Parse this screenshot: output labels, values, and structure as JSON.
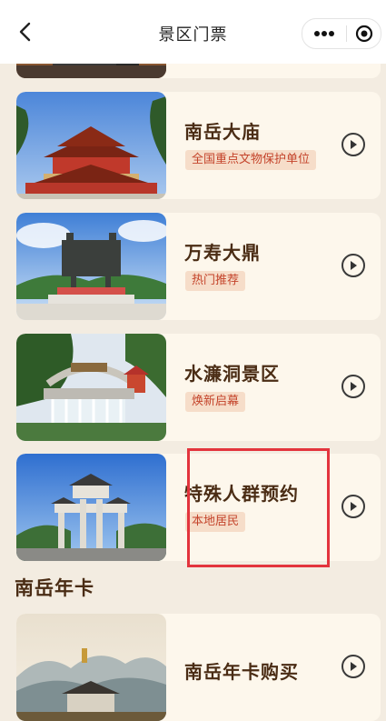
{
  "nav": {
    "title": "景区门票",
    "back_icon": "chevron-left-icon",
    "more_icon": "more-dots-icon",
    "close_icon": "target-circle-icon"
  },
  "cards": [
    {
      "name": "",
      "tag": ""
    },
    {
      "name": "南岳大庙",
      "tag": "全国重点文物保护单位"
    },
    {
      "name": "万寿大鼎",
      "tag": "热门推荐"
    },
    {
      "name": "水濂洞景区",
      "tag": "焕新启幕"
    },
    {
      "name": "特殊人群预约",
      "tag": "本地居民"
    }
  ],
  "section": {
    "title": "南岳年卡"
  },
  "annual_card": {
    "name": "南岳年卡购买"
  },
  "colors": {
    "highlight": "#e3343d",
    "accent_text": "#c4442b",
    "tag_bg": "#f6ddc9",
    "page_bg": "#f3ece1"
  }
}
